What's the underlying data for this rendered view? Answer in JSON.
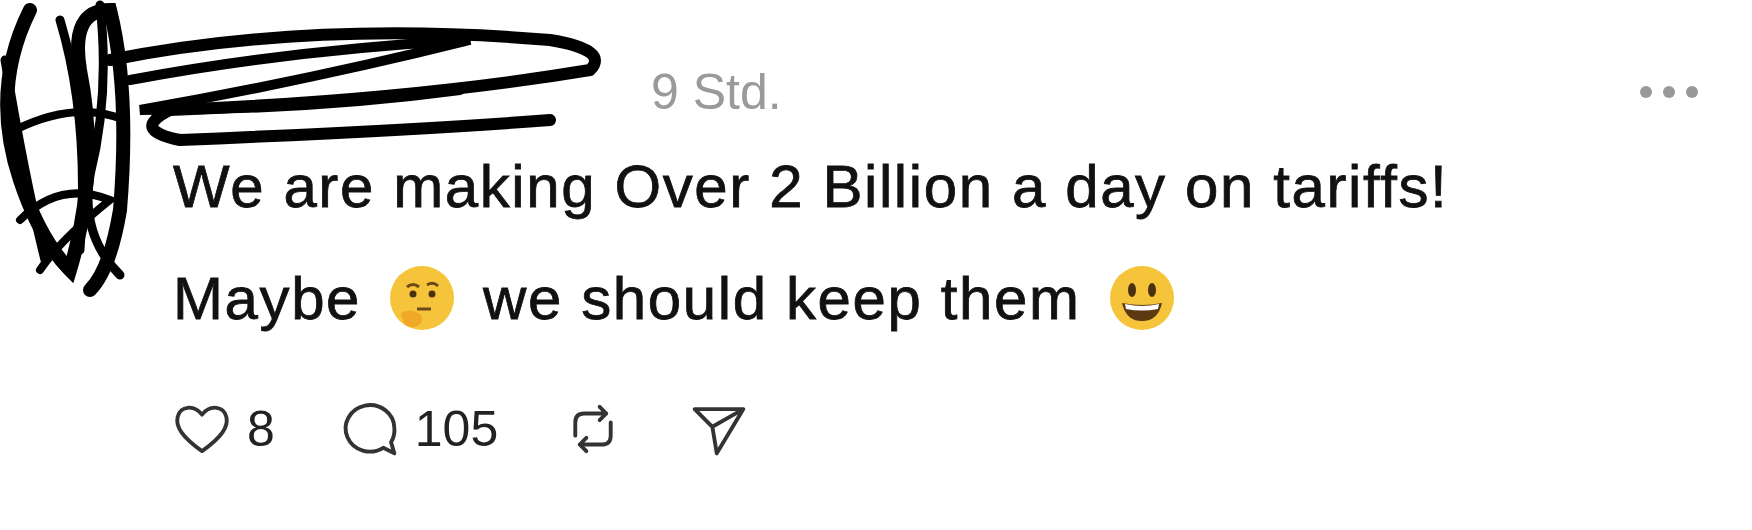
{
  "post": {
    "time": "9 Std.",
    "lines": [
      [
        {
          "kind": "text",
          "text": "We are making Over 2 Billion a day on tariffs!"
        }
      ],
      [
        {
          "kind": "text",
          "text": "Maybe"
        },
        {
          "kind": "thinking"
        },
        {
          "kind": "text",
          "text": "we should keep them"
        },
        {
          "kind": "smiley"
        }
      ]
    ]
  },
  "actions": [
    {
      "kind": "like",
      "count": "8"
    },
    {
      "kind": "reply",
      "count": "105"
    },
    {
      "kind": "repost"
    },
    {
      "kind": "share"
    }
  ]
}
